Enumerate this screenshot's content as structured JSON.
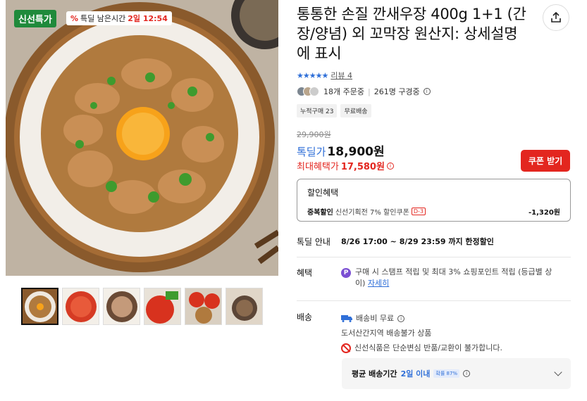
{
  "hero": {
    "badge_fresh": "신선특가",
    "badge_time_label": "특딜 남은시간",
    "badge_time_value": "2일 12:54"
  },
  "thumbnails": [
    "thumb-1",
    "thumb-2",
    "thumb-3",
    "thumb-4",
    "thumb-5",
    "thumb-6"
  ],
  "product": {
    "title": "통통한 손질 깐새우장 400g 1+1 (간장/양념) 외 꼬막장 원산지: 상세설명에 표시",
    "stars": "★★★★★",
    "review_link": "리뷰 4",
    "orders": "18개 주문중",
    "buyers": "261명 구경중",
    "tags": [
      "누적구매 23",
      "무료배송"
    ],
    "original_price": "29,900원",
    "deal_label": "톡딜가",
    "deal_price": "18,900원",
    "max_benefit_label": "최대혜택가",
    "max_benefit_price": "17,580원",
    "coupon_button": "쿠폰 받기"
  },
  "discount": {
    "heading": "할인혜택",
    "row_key": "중복할인",
    "row_value": "신선기획전 7% 할인쿠폰",
    "row_badge": "D-3",
    "amount": "-1,320원"
  },
  "deal_info": {
    "label": "톡딜 안내",
    "value": "8/26 17:00 ~ 8/29 23:59 까지 한정할인"
  },
  "benefit": {
    "label": "혜택",
    "icon": "P",
    "text": "구매 시 스탬프 적립 및 최대 3% 쇼핑포인트 적립 (등급별 상이)",
    "link": "자세히"
  },
  "shipping": {
    "label": "배송",
    "fee": "배송비 무료",
    "area": "도서산간지역 배송불가 상품",
    "notice": "신선식품은 단순변심 반품/교환이 불가합니다."
  },
  "delivery": {
    "label": "평균 배송기간",
    "value": "2일 이내",
    "chip": "확률 87%"
  },
  "colors": {
    "accent_blue": "#2f6fd8",
    "accent_red": "#e3261f",
    "fresh_green": "#1f8a3b"
  }
}
